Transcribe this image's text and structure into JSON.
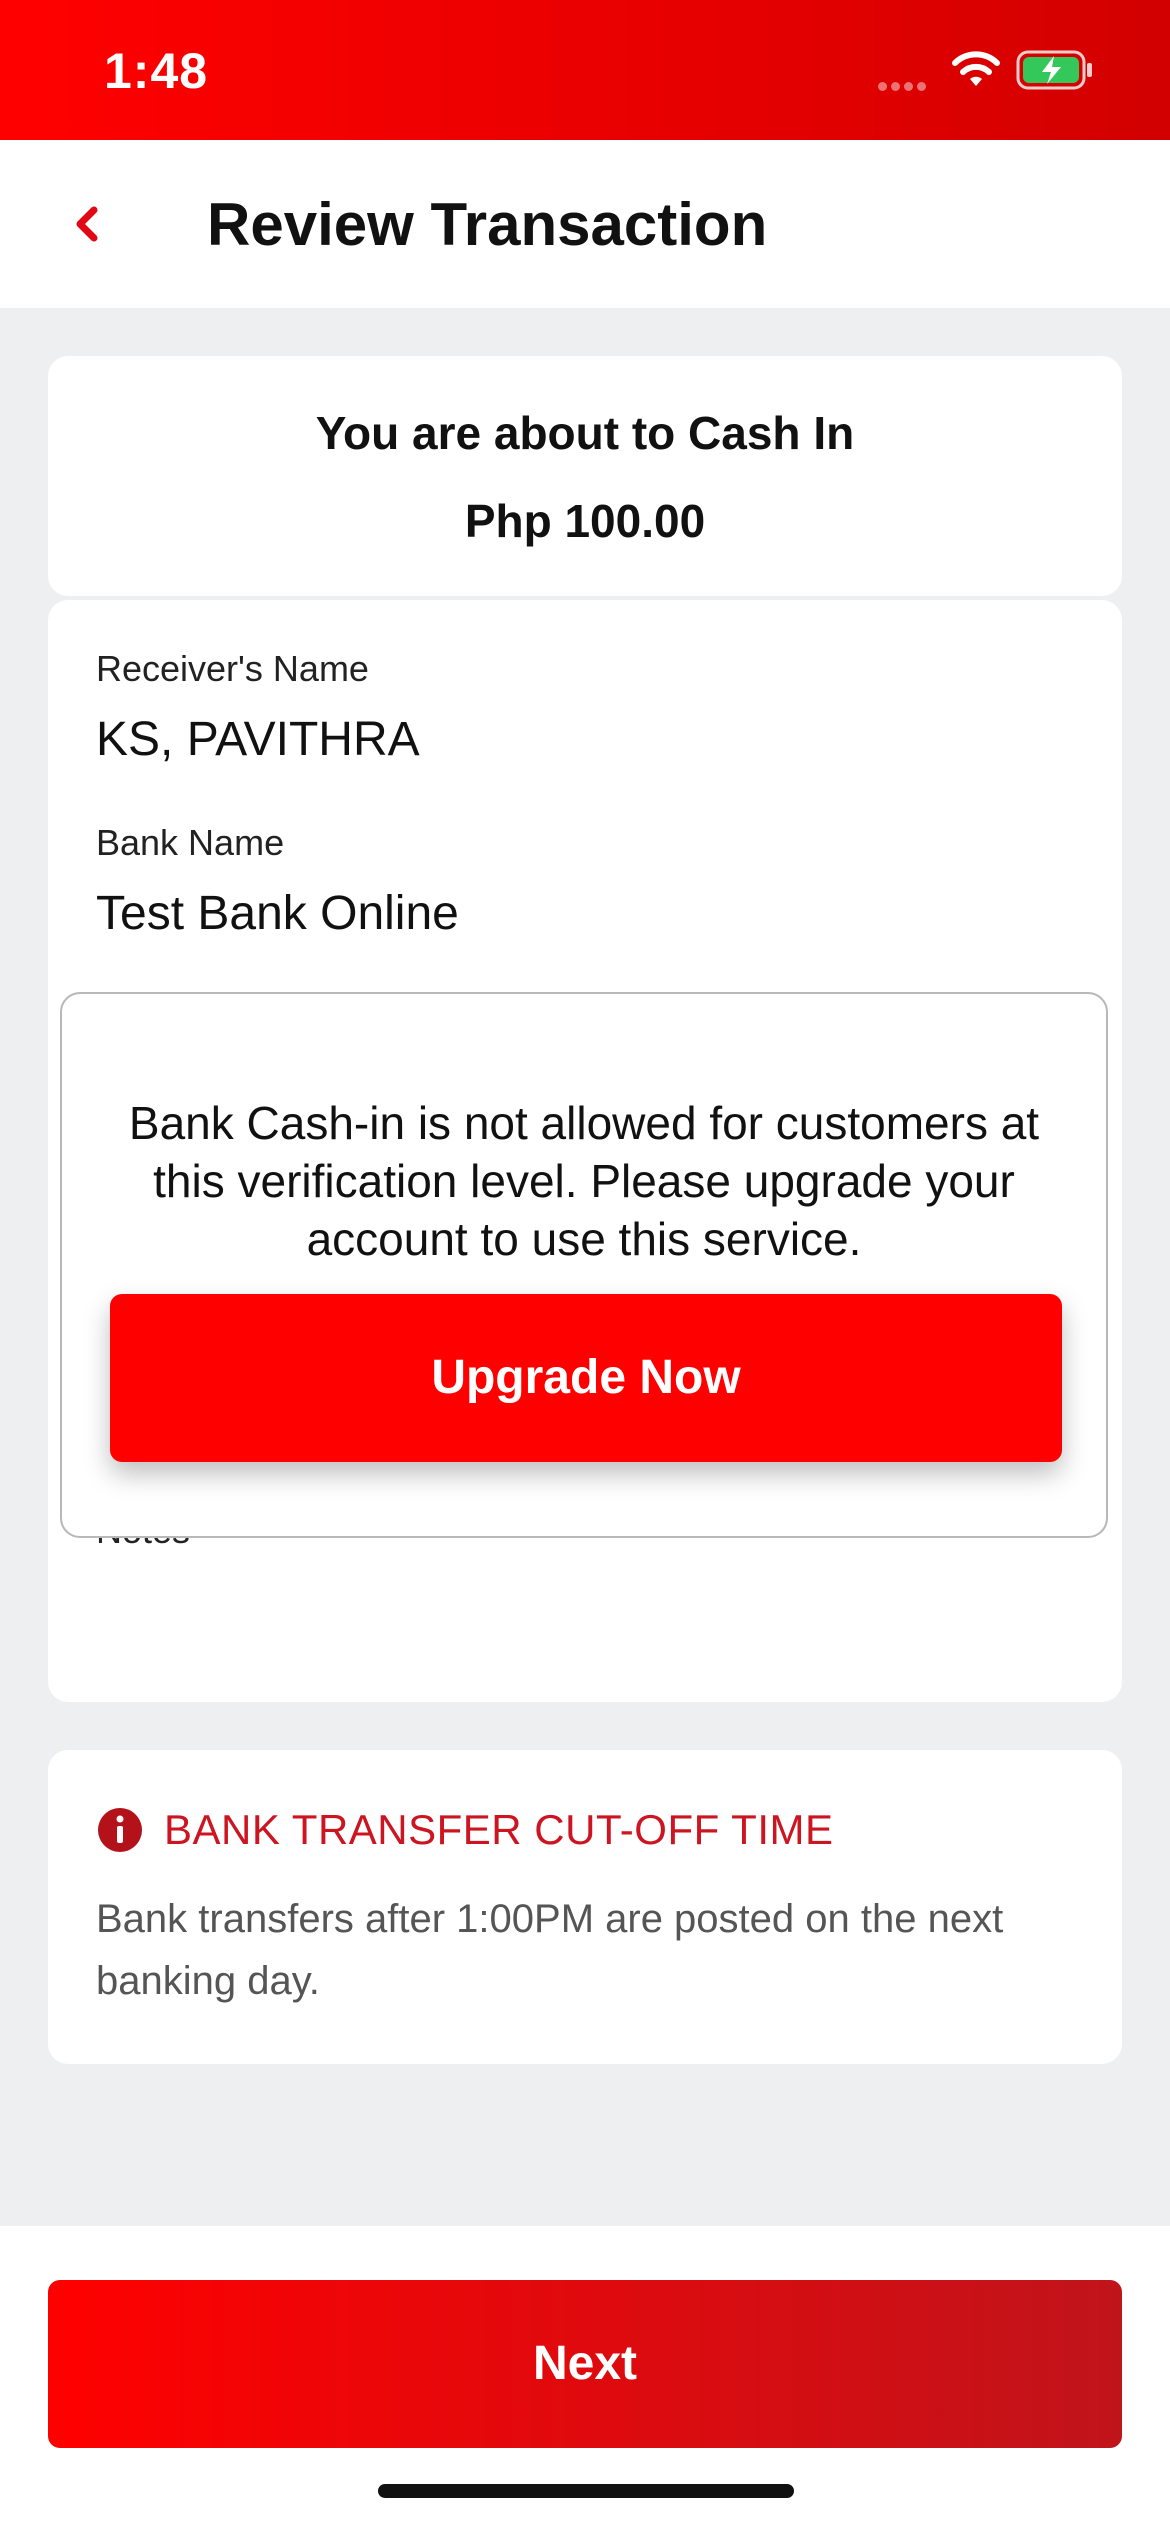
{
  "status_bar": {
    "time": "1:48",
    "icons": [
      "signal-icon",
      "wifi-icon",
      "battery-charging-icon"
    ]
  },
  "header": {
    "back_icon": "chevron-left-icon",
    "title": "Review Transaction"
  },
  "summary": {
    "line1": "You are about to Cash In",
    "amount": "Php 100.00"
  },
  "details": {
    "receiver_label": "Receiver's Name",
    "receiver_value": "KS, PAVITHRA",
    "bank_label": "Bank Name",
    "bank_value": "Test Bank Online",
    "notes_label": "Notes"
  },
  "modal": {
    "message": "Bank Cash-in is not allowed for customers at this verification level. Please upgrade your account to use this service.",
    "button_label": "Upgrade Now"
  },
  "cutoff": {
    "icon": "info-icon",
    "title": "BANK TRANSFER CUT-OFF TIME",
    "text": "Bank transfers after 1:00PM are posted on the next banking day."
  },
  "footer": {
    "next_label": "Next"
  },
  "colors": {
    "brand_red": "#ff0000",
    "dark_red": "#c0141b",
    "alert_red": "#cc1520",
    "battery_green": "#34c759"
  }
}
